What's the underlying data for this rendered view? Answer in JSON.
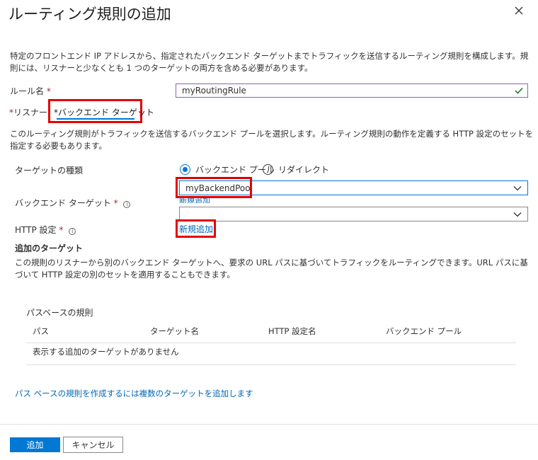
{
  "header": {
    "title": "ルーティング規則の追加"
  },
  "description": "特定のフロントエンド IP アドレスから、指定されたバックエンド ターゲットまでトラフィックを送信するルーティング規則を構成します。規則には、リスナーと少なくとも 1 つのターゲットの両方を含める必要があります。",
  "rule_name": {
    "label": "ルール名",
    "required_mark": "*",
    "value": "myRoutingRule"
  },
  "tabs": [
    {
      "label": "*リスナー",
      "active": false
    },
    {
      "label": "*バックエンド ターゲット",
      "active": true
    }
  ],
  "backend_section": {
    "description": "このルーティング規則がトラフィックを送信するバックエンド プールを選択します。ルーティング規則の動作を定義する HTTP 設定のセットを指定する必要もあります。",
    "target_type_label": "ターゲットの種類",
    "radio_options": [
      {
        "label": "バックエンド プール",
        "selected": true
      },
      {
        "label": "リダイレクト",
        "selected": false
      }
    ],
    "backend_target_label": "バックエンド ターゲット",
    "backend_target_required": "*",
    "backend_target_value": "myBackendPool",
    "backend_target_add_new": "新規追加",
    "http_settings_label": "HTTP 設定",
    "http_settings_required": "*",
    "http_settings_value": "",
    "http_settings_add_new": "新規追加"
  },
  "additional_targets": {
    "heading": "追加のターゲット",
    "description": "この規則のリスナーから別のバックエンド ターゲットへ、要求の URL パスに基づいてトラフィックをルーティングできます。URL パスに基づいて HTTP 設定の別のセットを適用することもできます。",
    "path_rules_heading": "パスベースの規則",
    "columns": [
      "パス",
      "ターゲット名",
      "HTTP 設定名",
      "バックエンド プール"
    ],
    "empty_message": "表示する追加のターゲットがありません",
    "add_link": "パス ベースの規則を作成するには複数のターゲットを追加します"
  },
  "footer": {
    "add_button": "追加",
    "cancel_button": "キャンセル"
  },
  "colors": {
    "accent": "#0078d4",
    "highlight": "#e50000",
    "valid": "#107c10",
    "active_input_border": "#8764b8"
  }
}
